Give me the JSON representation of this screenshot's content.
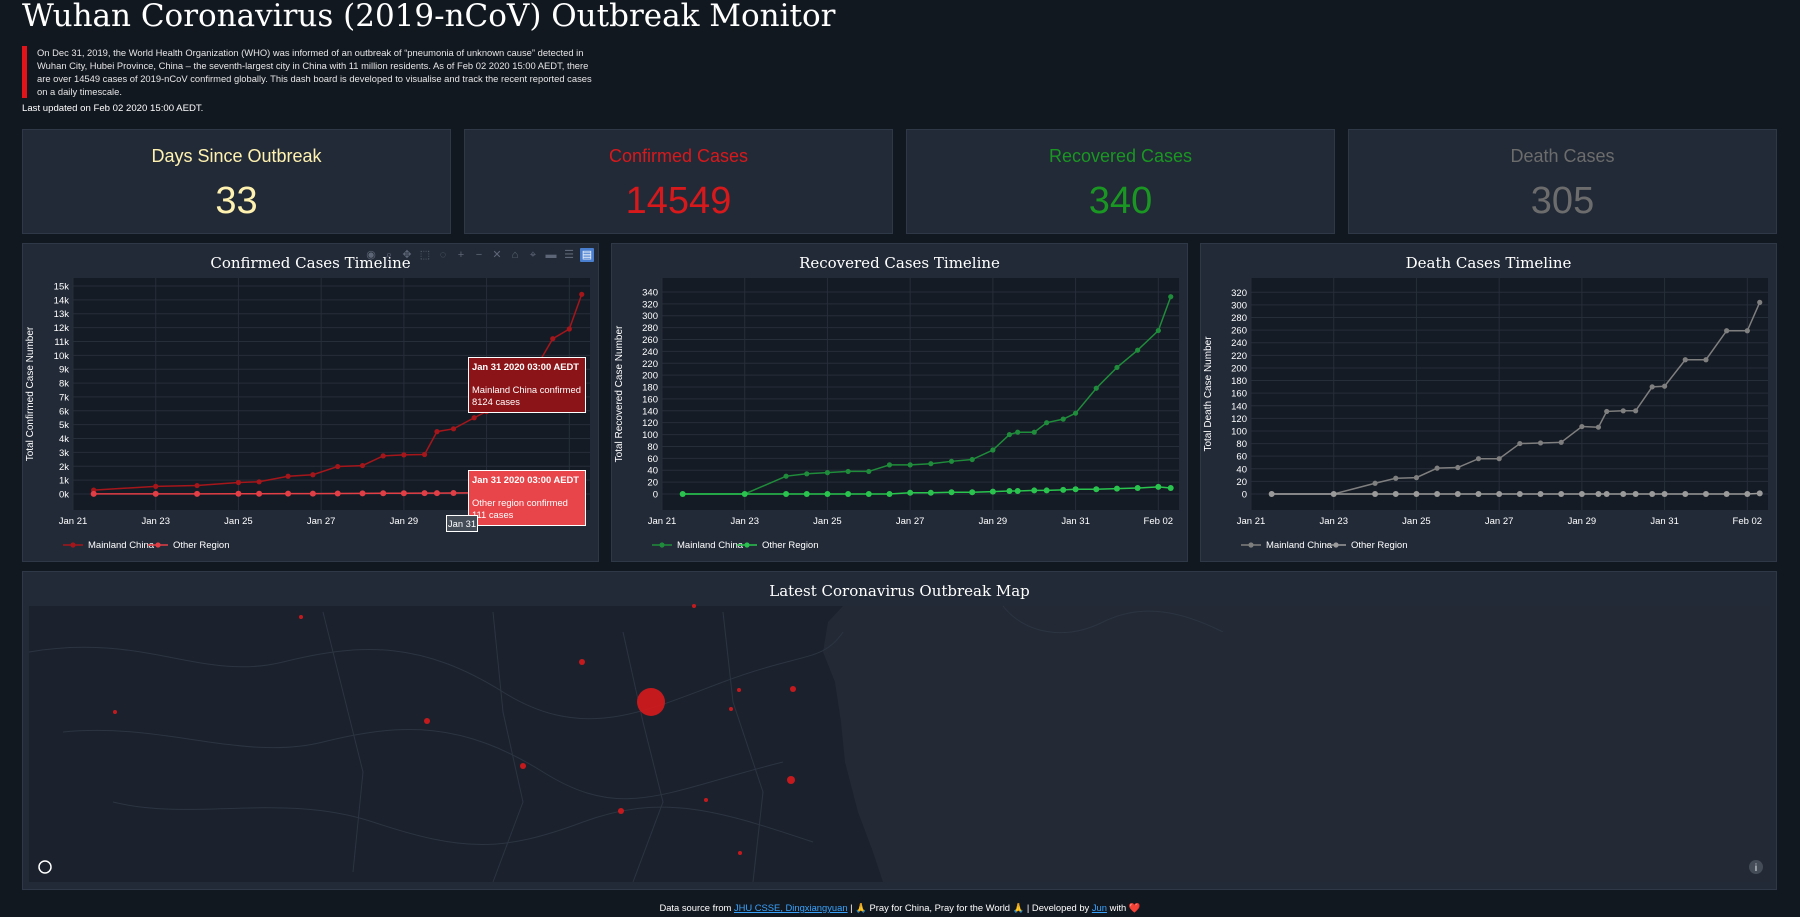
{
  "header": {
    "title": "Wuhan Coronavirus (2019-nCoV) Outbreak Monitor",
    "intro": "On Dec 31, 2019, the World Health Organization (WHO) was informed of an outbreak of “pneumonia of unknown cause” detected in Wuhan City, Hubei Province, China – the seventh-largest city in China with 11 million residents. As of Feb 02 2020 15:00 AEDT, there are over 14549 cases of 2019-nCoV confirmed globally. This dash board is developed to visualise and track the recent reported cases on a daily timescale.",
    "last_updated": "Last updated on Feb 02 2020 15:00 AEDT."
  },
  "cards": [
    {
      "label": "Days Since Outbreak",
      "value": "33",
      "color": "#fff2b0"
    },
    {
      "label": "Confirmed Cases",
      "value": "14549",
      "color": "#d7191c"
    },
    {
      "label": "Recovered Cases",
      "value": "340",
      "color": "#1a9622"
    },
    {
      "label": "Death Cases",
      "value": "305",
      "color": "#6c6c6c"
    }
  ],
  "toolbar_icons": [
    "camera-icon",
    "zoom-icon",
    "pan-icon",
    "box-select-icon",
    "lasso-icon",
    "zoom-in-icon",
    "zoom-out-icon",
    "autoscale-icon",
    "reset-axes-icon",
    "spike-lines-icon",
    "hover-closest-icon",
    "hover-compare-icon",
    "plotly-logo-icon"
  ],
  "tooltips": {
    "mainland": {
      "title": "Jan 31 2020 03:00 AEDT",
      "line1": "Mainland China confirmed",
      "line2": "8124 cases",
      "color": "#8b1418"
    },
    "other": {
      "title": "Jan 31 2020 03:00 AEDT",
      "line1": "Other region confirmed",
      "line2": "111 cases",
      "color": "#e8454a"
    },
    "x_label": "Jan 31"
  },
  "map": {
    "title": "Latest Coronavirus Outbreak Map",
    "bubble_color": "#d7191c"
  },
  "footer": {
    "prefix": "Data source from",
    "source_link": "JHU CSSE, Dingxiangyuan",
    "middle": "| 🙏 Pray for China, Pray for the World 🙏 | Developed by",
    "author_link": "Jun",
    "suffix": "with ❤️"
  },
  "chart_data": [
    {
      "type": "line",
      "title": "Confirmed Cases Timeline",
      "ylabel": "Total Confirmed Case Number",
      "xlabel": "",
      "x_ticks": [
        "Jan 21",
        "Jan 23",
        "Jan 25",
        "Jan 27",
        "Jan 29",
        "Jan 31",
        "Feb 02"
      ],
      "y_ticks": [
        "0k",
        "1k",
        "2k",
        "3k",
        "4k",
        "5k",
        "6k",
        "7k",
        "8k",
        "9k",
        "10k",
        "11k",
        "12k",
        "13k",
        "14k",
        "15k"
      ],
      "ylim": [
        0,
        15000
      ],
      "xlim_days": [
        21,
        33.5
      ],
      "legend": "bottom-left",
      "series": [
        {
          "name": "Mainland China",
          "color": "#a5161b",
          "x": [
            21.5,
            23,
            24,
            25,
            25.5,
            26.2,
            26.8,
            27.4,
            28,
            28.5,
            29,
            29.5,
            29.8,
            30.2,
            30.7,
            31,
            31.2,
            31.7,
            32,
            32.6,
            33,
            33.3
          ],
          "y": [
            280,
            550,
            610,
            830,
            880,
            1280,
            1390,
            1980,
            2050,
            2750,
            2820,
            2850,
            4500,
            4700,
            5500,
            5950,
            6050,
            7700,
            8124,
            11200,
            11900,
            14400
          ]
        },
        {
          "name": "Other Region",
          "color": "#e23e45",
          "x": [
            21.5,
            23,
            24,
            25,
            25.5,
            26.2,
            26.8,
            27.4,
            28,
            28.5,
            29,
            29.5,
            29.8,
            30.2,
            30.7,
            31,
            31.2,
            31.7,
            32
          ],
          "y": [
            5,
            8,
            10,
            15,
            20,
            25,
            30,
            40,
            45,
            50,
            55,
            60,
            65,
            70,
            85,
            90,
            95,
            105,
            111
          ]
        }
      ]
    },
    {
      "type": "line",
      "title": "Recovered Cases Timeline",
      "ylabel": "Total Recovered Case Number",
      "xlabel": "",
      "x_ticks": [
        "Jan 21",
        "Jan 23",
        "Jan 25",
        "Jan 27",
        "Jan 29",
        "Jan 31",
        "Feb 02"
      ],
      "y_ticks": [
        "0",
        "20",
        "40",
        "60",
        "80",
        "100",
        "120",
        "140",
        "160",
        "180",
        "200",
        "220",
        "240",
        "260",
        "280",
        "300",
        "320",
        "340"
      ],
      "ylim": [
        0,
        350
      ],
      "xlim_days": [
        21,
        33.5
      ],
      "legend": "bottom-left",
      "series": [
        {
          "name": "Mainland China",
          "color": "#1f8c3b",
          "x": [
            21.5,
            23,
            24,
            24.5,
            25,
            25.5,
            26,
            26.5,
            27,
            27.5,
            28,
            28.5,
            29,
            29.4,
            29.6,
            30,
            30.3,
            30.7,
            31,
            31.5,
            32,
            32.5,
            33,
            33.3
          ],
          "y": [
            0,
            0,
            30,
            34,
            36,
            38,
            38,
            49,
            49,
            51,
            55,
            58,
            74,
            100,
            104,
            104,
            120,
            126,
            136,
            178,
            213,
            242,
            275,
            332
          ]
        },
        {
          "name": "Other Region",
          "color": "#29c34e",
          "x": [
            21.5,
            23,
            24,
            24.5,
            25,
            25.5,
            26,
            26.5,
            27,
            27.5,
            28,
            28.5,
            29,
            29.4,
            29.6,
            30,
            30.3,
            30.7,
            31,
            31.5,
            32,
            32.5,
            33,
            33.3
          ],
          "y": [
            0,
            0,
            0,
            0,
            0,
            0,
            0,
            0,
            2,
            2,
            3,
            3,
            4,
            5,
            5,
            6,
            6,
            7,
            8,
            8,
            9,
            10,
            12,
            10
          ]
        }
      ]
    },
    {
      "type": "line",
      "title": "Death Cases Timeline",
      "ylabel": "Total Death Case Number",
      "xlabel": "",
      "x_ticks": [
        "Jan 21",
        "Jan 23",
        "Jan 25",
        "Jan 27",
        "Jan 29",
        "Jan 31",
        "Feb 02"
      ],
      "y_ticks": [
        "0",
        "20",
        "40",
        "60",
        "80",
        "100",
        "120",
        "140",
        "160",
        "180",
        "200",
        "220",
        "240",
        "260",
        "280",
        "300",
        "320"
      ],
      "ylim": [
        0,
        330
      ],
      "xlim_days": [
        21,
        33.5
      ],
      "legend": "bottom-left",
      "series": [
        {
          "name": "Mainland China",
          "color": "#7f7f7f",
          "x": [
            21.5,
            23,
            24,
            24.5,
            25,
            25.5,
            26,
            26.5,
            27,
            27.5,
            28,
            28.5,
            29,
            29.4,
            29.6,
            30,
            30.3,
            30.7,
            31,
            31.5,
            32,
            32.5,
            33,
            33.3
          ],
          "y": [
            0,
            0,
            17,
            25,
            26,
            41,
            42,
            56,
            56,
            80,
            81,
            82,
            107,
            106,
            131,
            132,
            132,
            170,
            171,
            213,
            213,
            259,
            259,
            304
          ]
        },
        {
          "name": "Other Region",
          "color": "#9a9a9a",
          "x": [
            21.5,
            23,
            24,
            24.5,
            25,
            25.5,
            26,
            26.5,
            27,
            27.5,
            28,
            28.5,
            29,
            29.4,
            29.6,
            30,
            30.3,
            30.7,
            31,
            31.5,
            32,
            32.5,
            33,
            33.3
          ],
          "y": [
            0,
            0,
            0,
            0,
            0,
            0,
            0,
            0,
            0,
            0,
            0,
            0,
            0,
            0,
            0,
            0,
            0,
            0,
            0,
            0,
            0,
            0,
            0,
            1
          ]
        }
      ]
    }
  ]
}
